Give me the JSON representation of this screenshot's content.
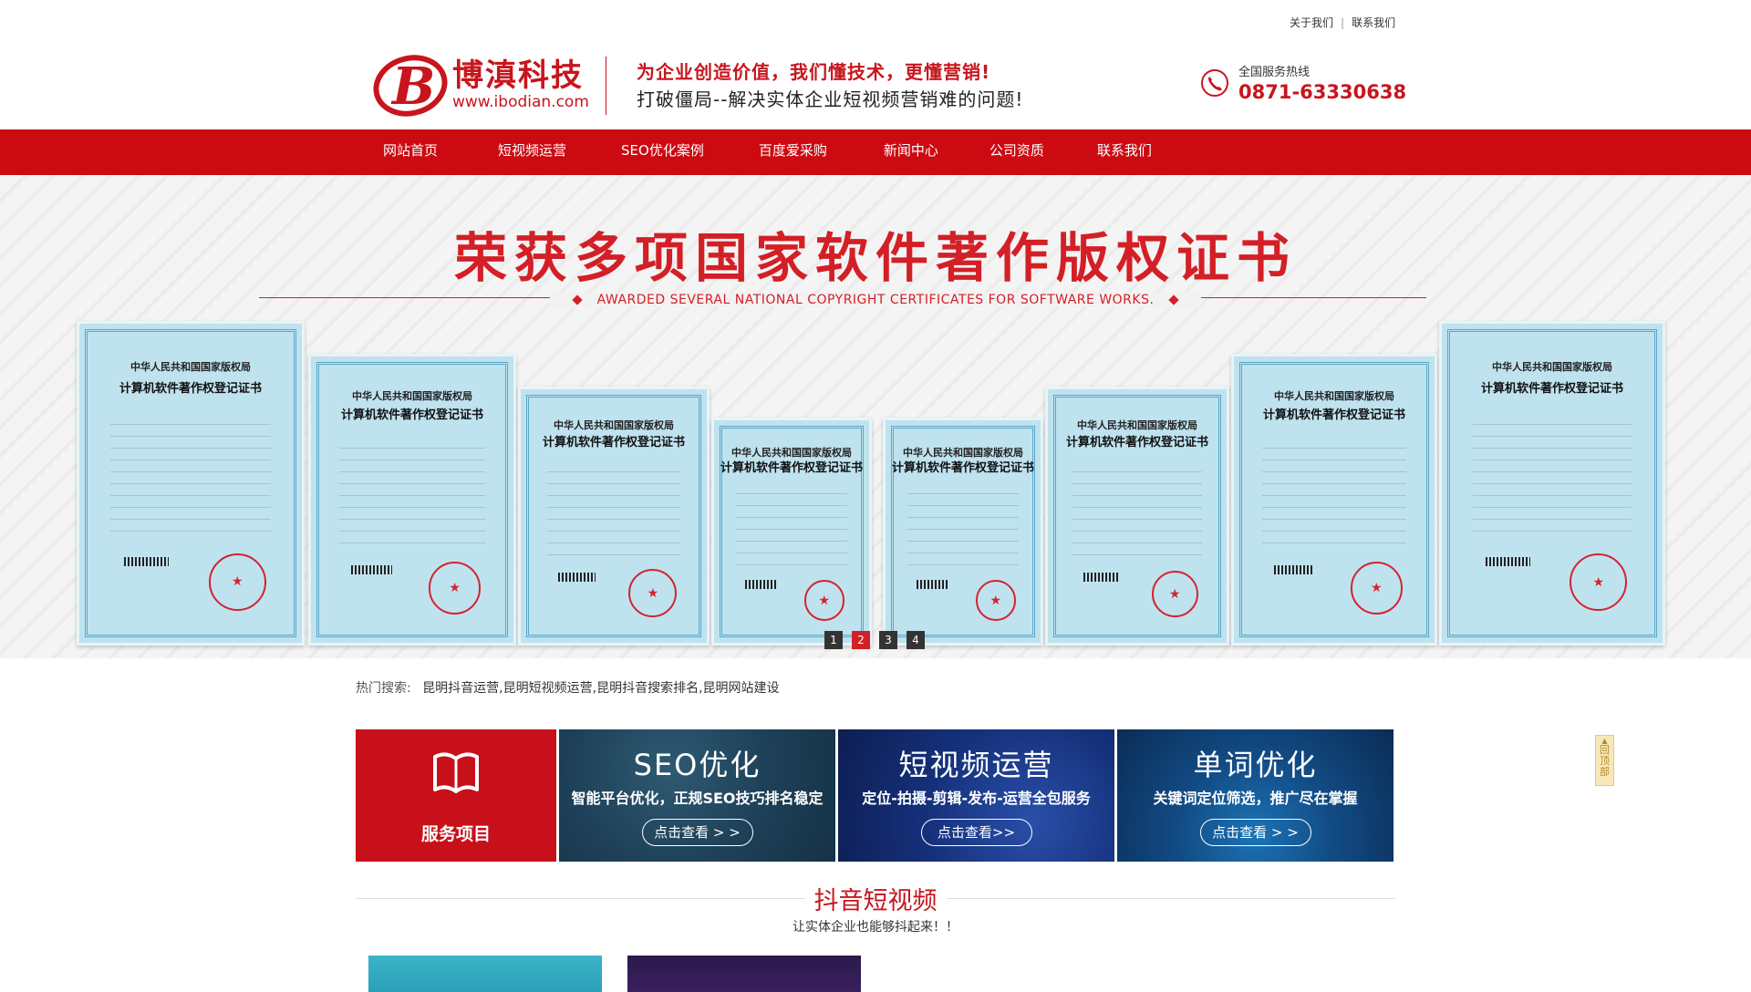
{
  "toplinks": {
    "about": "关于我们",
    "contact": "联系我们",
    "separator": "|"
  },
  "header": {
    "logo_name": "博滇科技",
    "logo_url": "www.ibodian.com",
    "slogan_1": "为企业创造价值，我们懂技术，更懂营销!",
    "slogan_2": "打破僵局--解决实体企业短视频营销难的问题!",
    "hotline_label": "全国服务热线",
    "hotline_number": "0871-63330638"
  },
  "nav": {
    "items": [
      {
        "label": "网站首页"
      },
      {
        "label": "短视频运营"
      },
      {
        "label": "SEO优化案例"
      },
      {
        "label": "百度爱采购"
      },
      {
        "label": "新闻中心"
      },
      {
        "label": "公司资质"
      },
      {
        "label": "联系我们"
      }
    ]
  },
  "banner": {
    "title": "荣获多项国家软件著作版权证书",
    "subtitle": "AWARDED SEVERAL NATIONAL COPYRIGHT CERTIFICATES FOR SOFTWARE WORKS.",
    "cert_title_1": "中华人民共和国国家版权局",
    "cert_title_2": "计算机软件著作权登记证书",
    "dots": [
      "1",
      "2",
      "3",
      "4"
    ],
    "active_dot": 2
  },
  "hot_search": {
    "label": "热门搜索:",
    "items": "昆明抖音运营,昆明短视频运营,昆明抖音搜索排名,昆明网站建设"
  },
  "services": {
    "head_label": "服务项目",
    "cards": [
      {
        "title": "SEO优化",
        "desc": "智能平台优化，正规SEO技巧排名稳定",
        "button": "点击查看 > >"
      },
      {
        "title": "短视频运营",
        "desc": "定位-拍摄-剪辑-发布-运营全包服务",
        "button": "点击查看>>"
      },
      {
        "title": "单词优化",
        "desc": "关键词定位筛选，推广尽在掌握",
        "button": "点击查看 > >"
      }
    ]
  },
  "backtop": {
    "label": "回顶部"
  },
  "section": {
    "title": "抖音短视频",
    "subtitle": "让实体企业也能够抖起来！！"
  },
  "colors": {
    "brand_red": "#cc0a12",
    "accent_red": "#d31f26"
  }
}
